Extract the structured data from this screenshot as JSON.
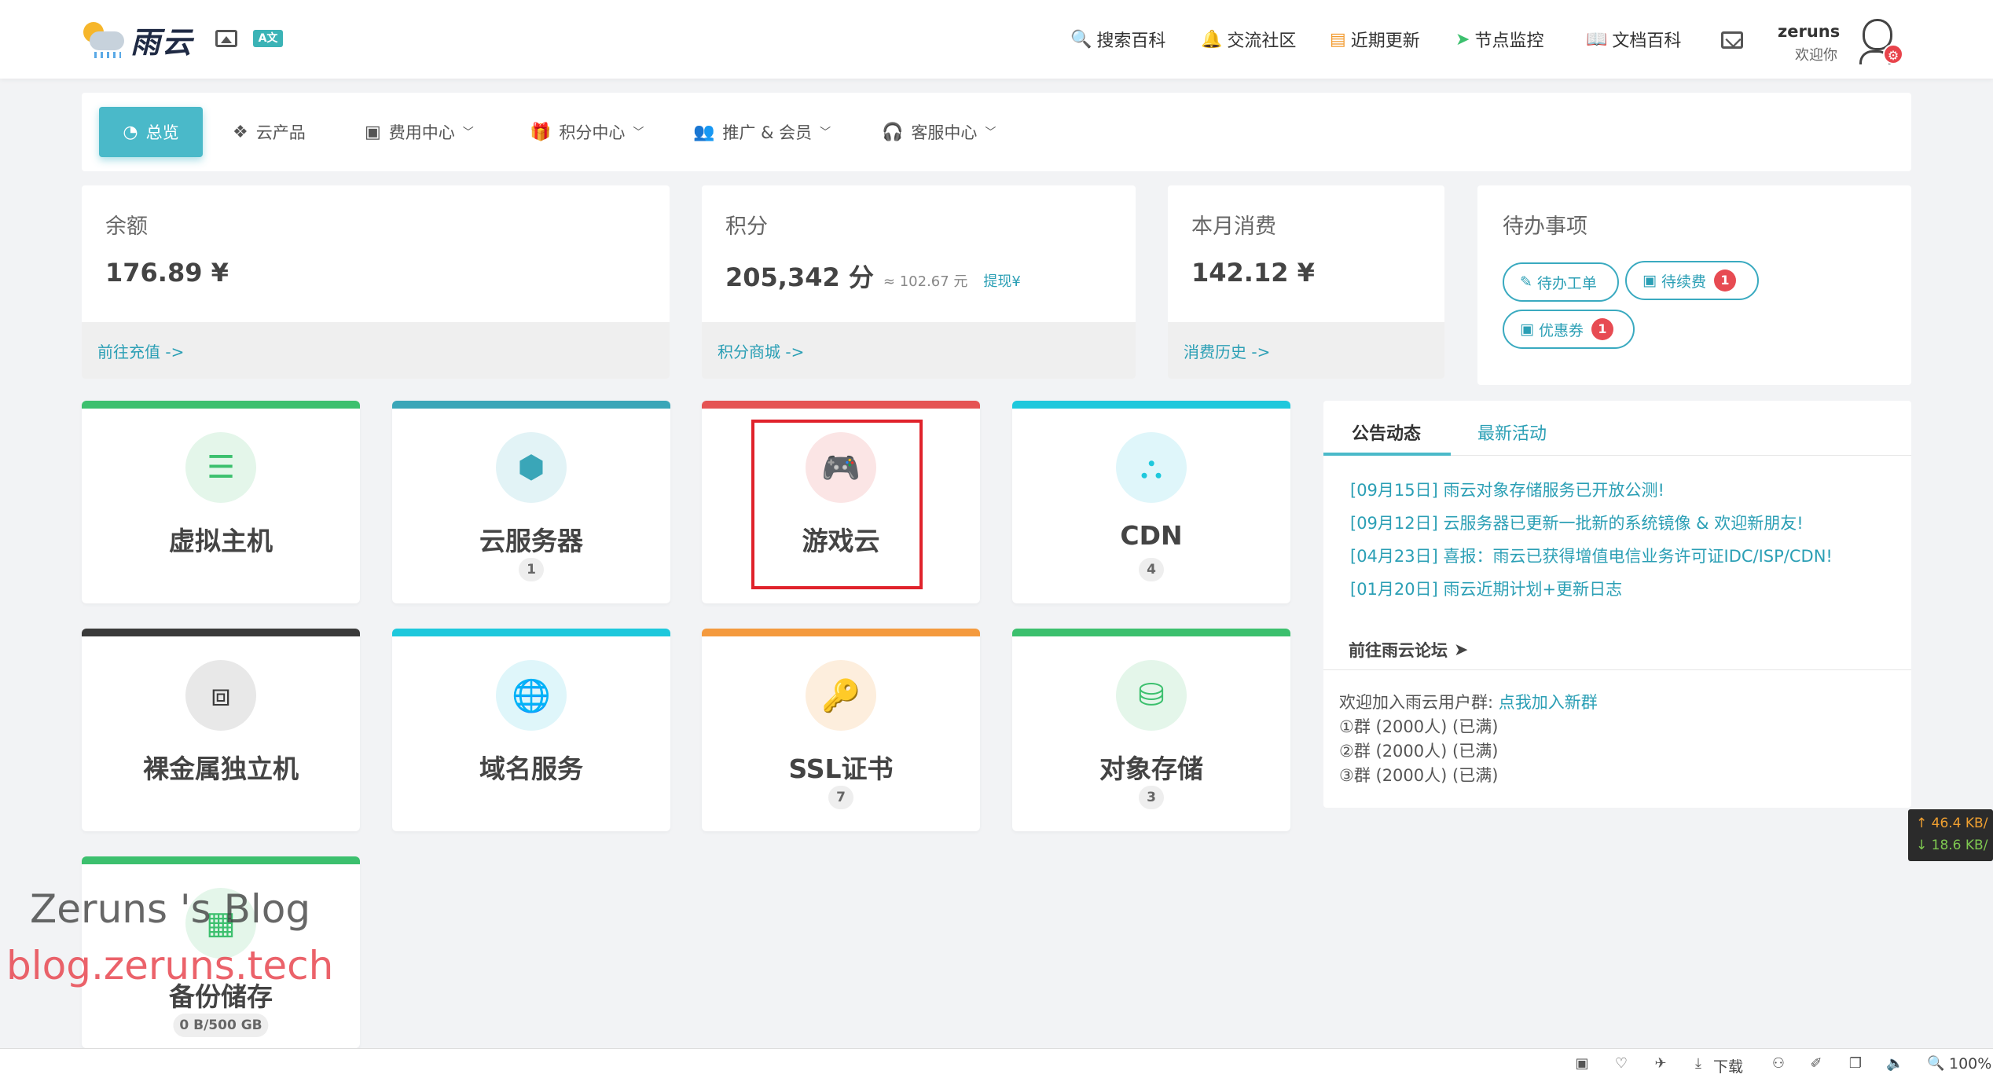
{
  "header": {
    "logo_text": "雨云",
    "translate_label": "A文",
    "nav": [
      {
        "label": "搜索百科",
        "icon": "search-icon"
      },
      {
        "label": "交流社区",
        "icon": "bell-icon"
      },
      {
        "label": "近期更新",
        "icon": "list-icon"
      },
      {
        "label": "节点监控",
        "icon": "paper-plane-icon"
      },
      {
        "label": "文档百科",
        "icon": "book-icon"
      }
    ],
    "user": {
      "name": "zeruns",
      "welcome": "欢迎你"
    }
  },
  "main_nav": [
    {
      "label": "总览",
      "active": true
    },
    {
      "label": "云产品"
    },
    {
      "label": "费用中心",
      "dropdown": true
    },
    {
      "label": "积分中心",
      "dropdown": true
    },
    {
      "label": "推广 & 会员",
      "dropdown": true
    },
    {
      "label": "客服中心",
      "dropdown": true
    }
  ],
  "stats": {
    "balance": {
      "label": "余额",
      "value": "176.89 ¥",
      "link": "前往充值 ->"
    },
    "points": {
      "label": "积分",
      "value": "205,342 分",
      "approx": "≈ 102.67 元",
      "withdraw": "提现¥",
      "link": "积分商城 ->"
    },
    "monthly": {
      "label": "本月消费",
      "value": "142.12 ¥",
      "link": "消费历史 ->"
    }
  },
  "todo": {
    "title": "待办事项",
    "items": [
      {
        "label": "待办工单"
      },
      {
        "label": "待续费",
        "badge": "1"
      },
      {
        "label": "优惠券",
        "badge": "1"
      }
    ]
  },
  "products": [
    {
      "name": "虚拟主机",
      "count": "",
      "color": "#3cc06e",
      "icon": "server-icon"
    },
    {
      "name": "云服务器",
      "count": "1",
      "color": "#3aa6b8",
      "icon": "cube-icon"
    },
    {
      "name": "游戏云",
      "count": "",
      "color": "#e55353",
      "icon": "gamepad-icon"
    },
    {
      "name": "CDN",
      "count": "4",
      "color": "#1ec8dc",
      "icon": "network-icon"
    },
    {
      "name": "裸金属独立机",
      "count": "",
      "color": "#3a3a3a",
      "icon": "frame-icon"
    },
    {
      "name": "域名服务",
      "count": "",
      "color": "#1ec8dc",
      "icon": "globe-icon"
    },
    {
      "name": "SSL证书",
      "count": "7",
      "color": "#f49a3e",
      "icon": "key-icon"
    },
    {
      "name": "对象存储",
      "count": "3",
      "color": "#3cc06e",
      "icon": "database-icon"
    },
    {
      "name": "备份储存",
      "count": "0 B/500 GB",
      "color": "#3cc06e",
      "icon": "archive-icon"
    }
  ],
  "news": {
    "tabs": [
      "公告动态",
      "最新活动"
    ],
    "items": [
      "[09月15日] 雨云对象存储服务已开放公测!",
      "[09月12日] 云服务器已更新一批新的系统镜像 & 欢迎新朋友!",
      "[04月23日] 喜报：雨云已获得增值电信业务许可证IDC/ISP/CDN!",
      "[01月20日] 雨云近期计划+更新日志"
    ],
    "forum_link": "前往雨云论坛",
    "join_text": "欢迎加入雨云用户群: ",
    "join_link": "点我加入新群",
    "groups": [
      "①群 (2000人) (已满)",
      "②群 (2000人) (已满)",
      "③群 (2000人) (已满)"
    ]
  },
  "speed": {
    "up": "↑ 46.4 KB/",
    "down": "↓ 18.6 KB/"
  },
  "watermark": {
    "title": "Zeruns 's Blog",
    "url": "blog.zeruns.tech"
  },
  "statusbar": {
    "download": "下载",
    "zoom": "100%"
  }
}
